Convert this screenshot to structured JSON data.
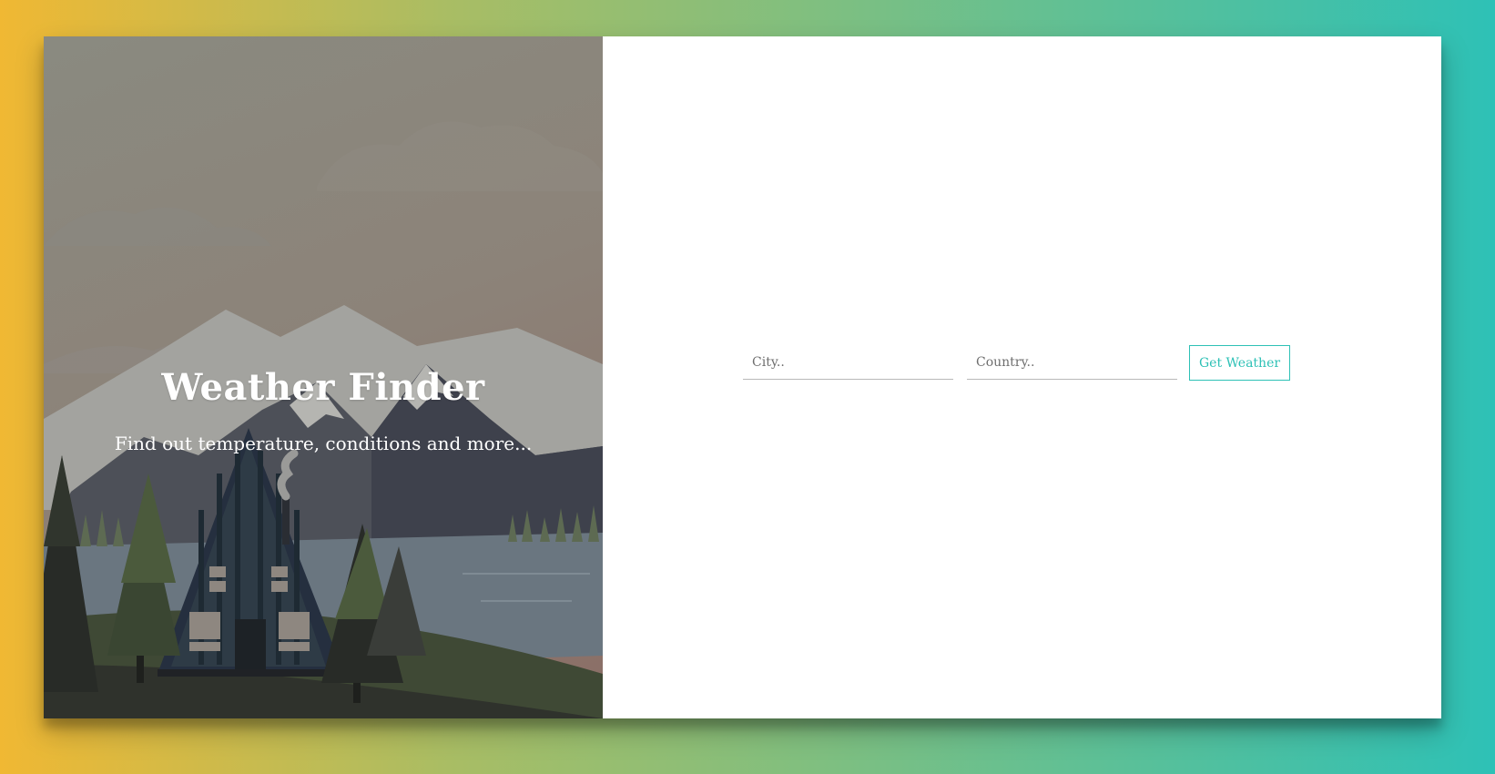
{
  "hero": {
    "title": "Weather Finder",
    "subtitle": "Find out temperature, conditions and more..."
  },
  "form": {
    "city_placeholder": "City..",
    "city_value": "",
    "country_placeholder": "Country..",
    "country_value": "",
    "submit_label": "Get Weather"
  },
  "colors": {
    "accent": "#2ec1b6",
    "gradient_start": "#f0b833",
    "gradient_end": "#2ec1b6"
  }
}
